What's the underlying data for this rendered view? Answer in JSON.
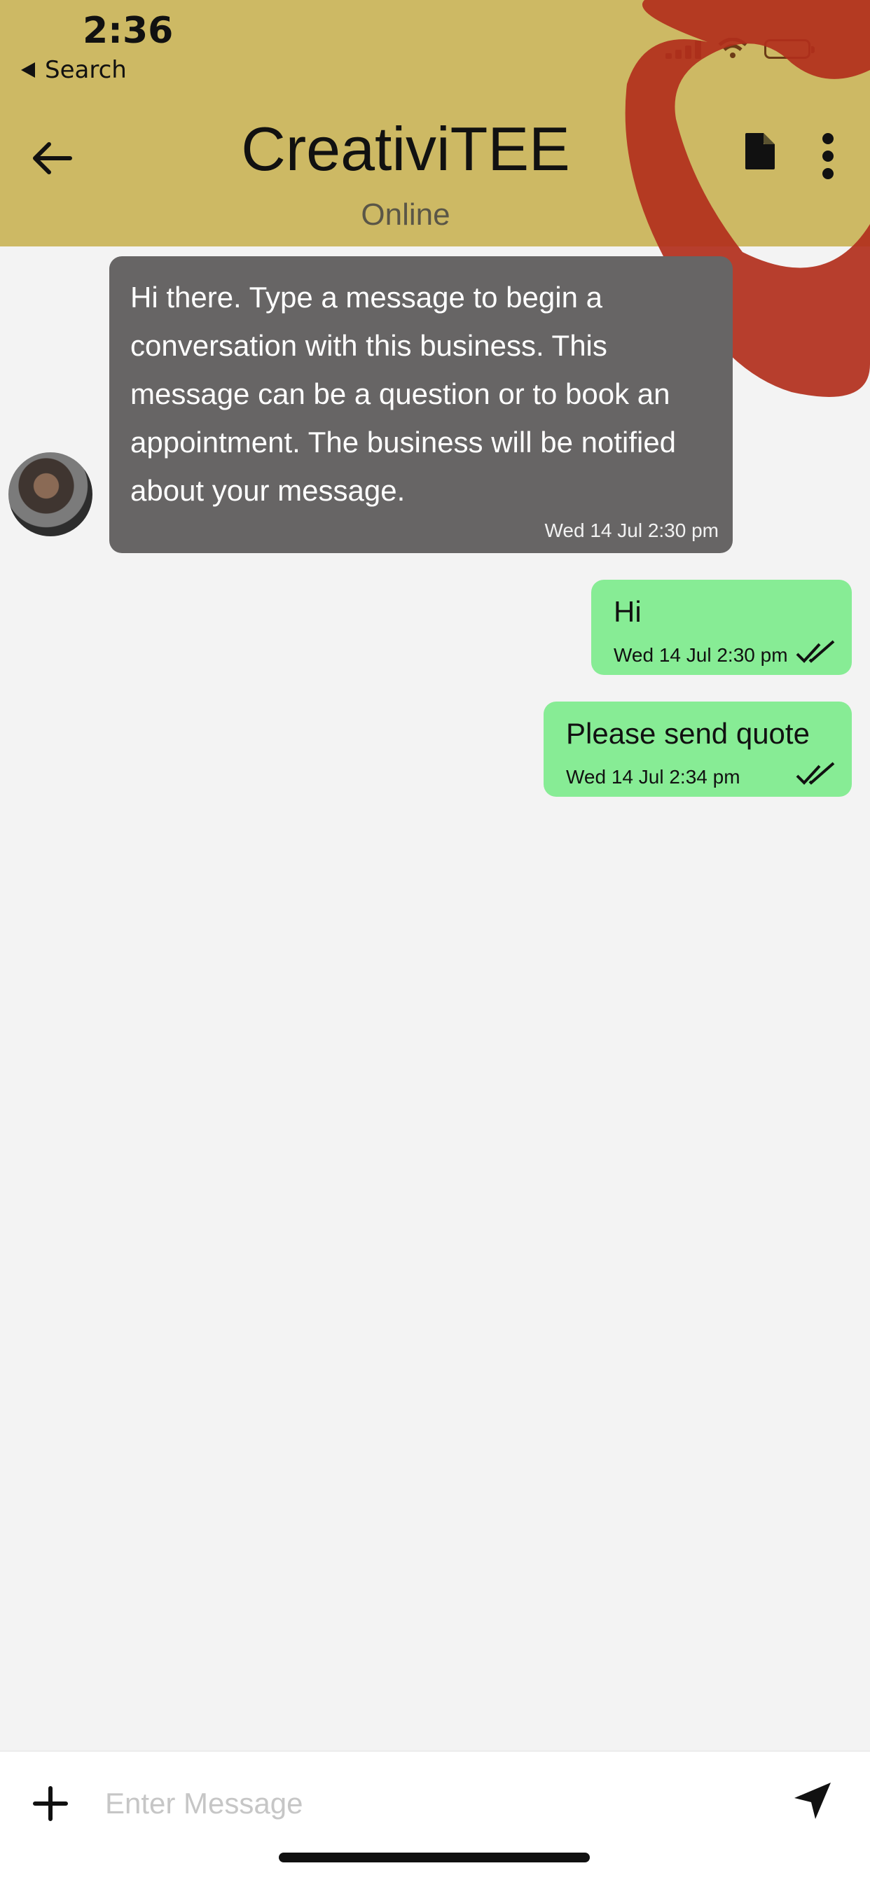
{
  "status_bar": {
    "time": "2:36",
    "back_label": "Search"
  },
  "header": {
    "title": "CreativiTEE",
    "subtitle": "Online",
    "background": "#cdb964"
  },
  "icons": {
    "back": "arrow-left-icon",
    "document": "document-icon",
    "more": "more-vertical-icon",
    "add": "plus-icon",
    "send": "send-icon",
    "read_receipt": "double-check-icon"
  },
  "messages": [
    {
      "direction": "incoming",
      "text": "Hi there. Type a message to begin a conversation with this business. This message can be a question or to book an appointment. The business will be notified about your message.",
      "time": "Wed 14 Jul 2:30 pm",
      "color": "#676565"
    },
    {
      "direction": "outgoing",
      "text": "Hi",
      "time": "Wed 14 Jul 2:30 pm",
      "color": "#87ec95"
    },
    {
      "direction": "outgoing",
      "text": "Please send quote",
      "time": "Wed 14 Jul 2:34 pm",
      "color": "#87ec95"
    }
  ],
  "composer": {
    "placeholder": "Enter Message",
    "value": ""
  }
}
